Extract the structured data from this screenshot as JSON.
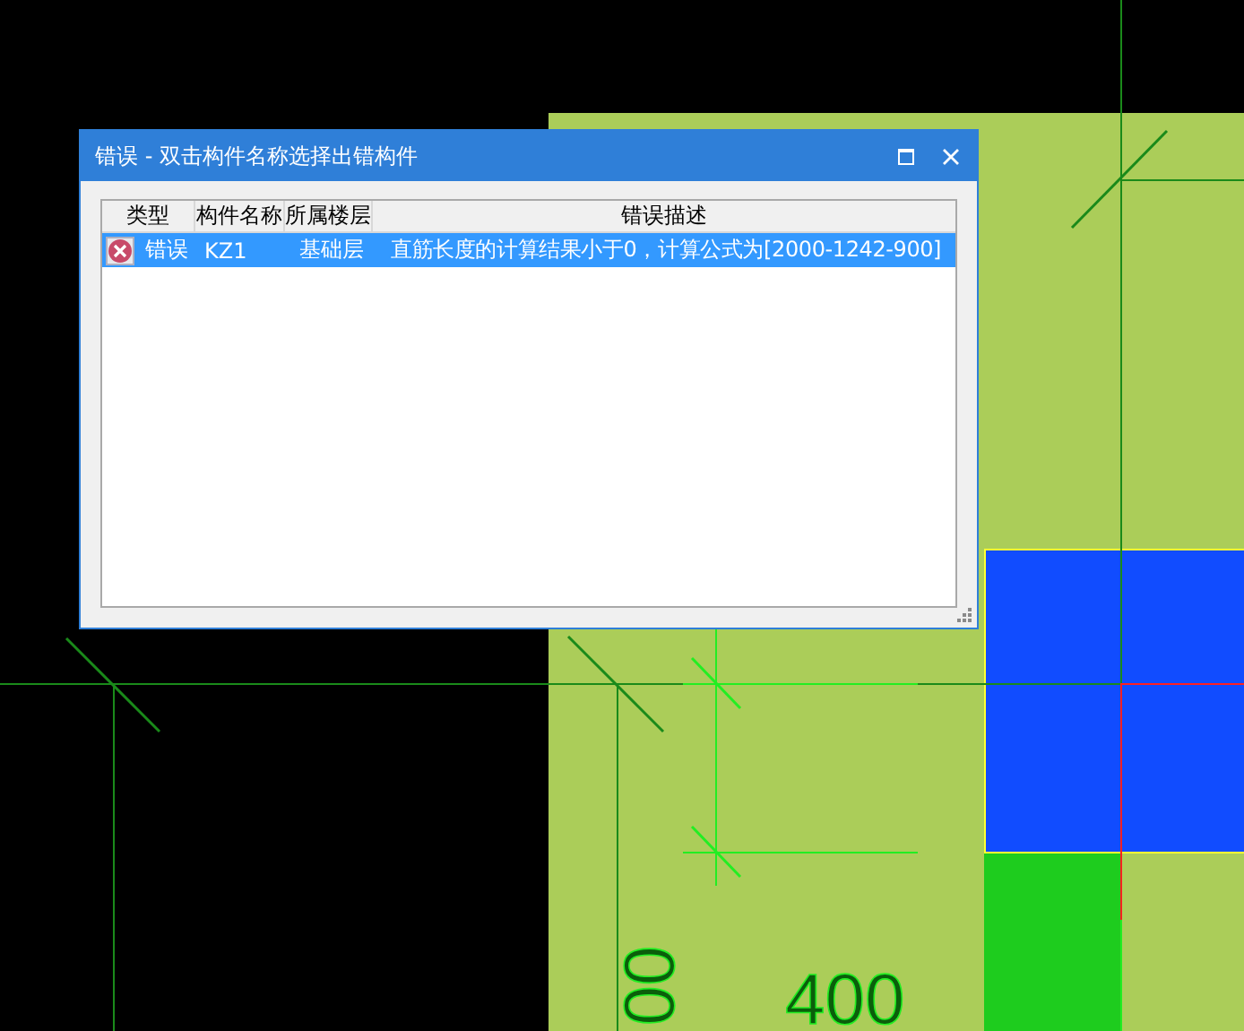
{
  "drawing": {
    "dimension_labels": [
      {
        "text": "400",
        "rotated": false
      },
      {
        "text": "00",
        "rotated": true
      }
    ]
  },
  "dialog": {
    "title": "错误 - 双击构件名称选择出错构件",
    "columns": [
      "类型",
      "构件名称",
      "所属楼层",
      "错误描述"
    ],
    "rows": [
      {
        "kind": "error",
        "selected": true,
        "cells": [
          "错误",
          "KZ1",
          "基础层",
          "直筋长度的计算结果小于0，计算公式为[2000-1242-900]"
        ]
      }
    ]
  }
}
